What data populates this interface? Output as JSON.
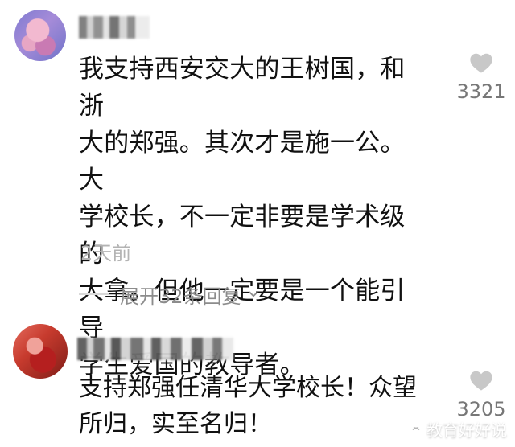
{
  "comments": [
    {
      "username": "王树国",
      "text": "我支持西安交大的王树国，和浙\n大的郑强。其次才是施一公。大\n学校长，不一定非要是学术级的\n大拿。但他一定要是一个能引导\n学生爱国的教导者。",
      "time": "2天前",
      "likes": "3321",
      "replies_label": "展开32条回复"
    },
    {
      "username": "",
      "text": "支持郑强任清华大学校长！众望\n所归，实至名归！",
      "likes": "3205"
    }
  ],
  "watermark": {
    "text": "教育好好说"
  },
  "icons": {
    "like": "heart-icon",
    "replies": "chevron-down-icon",
    "watermark": "watermark-icon"
  },
  "colors": {
    "text_primary": "#111111",
    "text_muted": "#b3b3b3",
    "reply_text": "#8c8c8c",
    "icon_gray": "#c8c8c8"
  }
}
